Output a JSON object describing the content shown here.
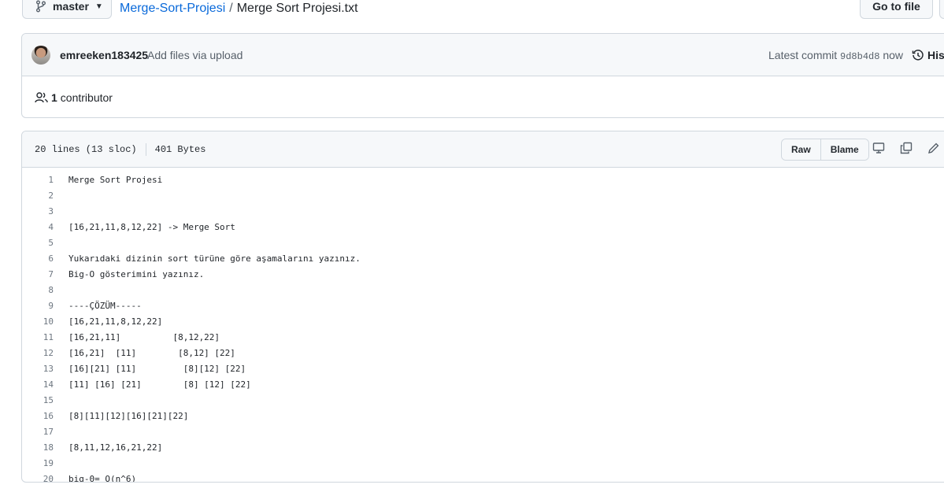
{
  "topbar": {
    "branch": "master",
    "repo": "Merge-Sort-Projesi",
    "separator": "/",
    "filename": "Merge Sort Projesi.txt",
    "goto_label": "Go to file"
  },
  "commit": {
    "author": "emreeken183425",
    "message": "Add files via upload",
    "latest_label": "Latest commit",
    "sha": "9d8b4d8",
    "when": "now",
    "history_label": "History"
  },
  "contributors": {
    "count": "1",
    "label": "contributor"
  },
  "file": {
    "lines_info": "20 lines (13 sloc)",
    "size": "401 Bytes",
    "raw_label": "Raw",
    "blame_label": "Blame",
    "lines": [
      {
        "n": "1",
        "text": "Merge Sort Projesi"
      },
      {
        "n": "2",
        "text": ""
      },
      {
        "n": "3",
        "text": ""
      },
      {
        "n": "4",
        "text": "[16,21,11,8,12,22] -> Merge Sort"
      },
      {
        "n": "5",
        "text": ""
      },
      {
        "n": "6",
        "text": "Yukarıdaki dizinin sort türüne göre aşamalarını yazınız."
      },
      {
        "n": "7",
        "text": "Big-O gösterimini yazınız."
      },
      {
        "n": "8",
        "text": ""
      },
      {
        "n": "9",
        "text": "----ÇÖZÜM-----"
      },
      {
        "n": "10",
        "text": "[16,21,11,8,12,22]"
      },
      {
        "n": "11",
        "text": "[16,21,11]          [8,12,22]"
      },
      {
        "n": "12",
        "text": "[16,21]  [11]        [8,12] [22]"
      },
      {
        "n": "13",
        "text": "[16][21] [11]         [8][12] [22]"
      },
      {
        "n": "14",
        "text": "[11] [16] [21]        [8] [12] [22]"
      },
      {
        "n": "15",
        "text": ""
      },
      {
        "n": "16",
        "text": "[8][11][12][16][21][22]"
      },
      {
        "n": "17",
        "text": ""
      },
      {
        "n": "18",
        "text": "[8,11,12,16,21,22]"
      },
      {
        "n": "19",
        "text": ""
      },
      {
        "n": "20",
        "text": "big-0= O(n^6)"
      }
    ]
  }
}
